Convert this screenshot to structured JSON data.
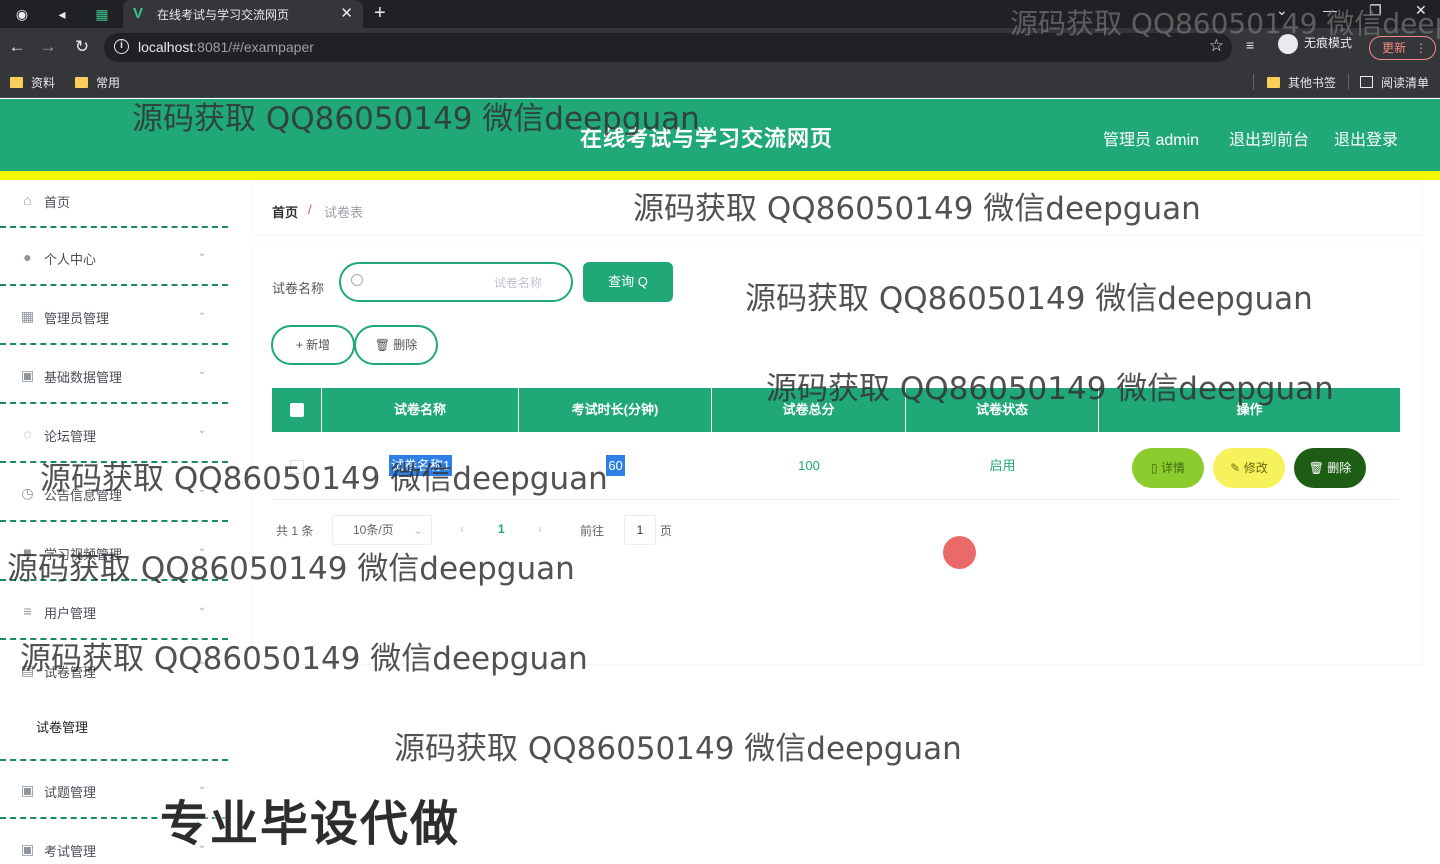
{
  "browser": {
    "tab_title": "在线考试与学习交流网页",
    "url_host": "localhost",
    "url_rest": ":8081/#/exampaper",
    "incognito_label": "无痕模式",
    "update_label": "更新",
    "bookmarks": [
      "资料",
      "常用"
    ],
    "bookmarks_right": [
      "其他书签",
      "阅读清单"
    ]
  },
  "header": {
    "title": "在线考试与学习交流网页",
    "user_label": "管理员 admin",
    "to_front_label": "退出到前台",
    "logout_label": "退出登录"
  },
  "sidebar": {
    "items": [
      {
        "label": "首页",
        "icon": "home-icon",
        "expandable": false
      },
      {
        "label": "个人中心",
        "icon": "user-icon",
        "expandable": true
      },
      {
        "label": "管理员管理",
        "icon": "grid-icon",
        "expandable": true
      },
      {
        "label": "基础数据管理",
        "icon": "clipboard-icon",
        "expandable": true
      },
      {
        "label": "论坛管理",
        "icon": "power-icon",
        "expandable": true
      },
      {
        "label": "公告信息管理",
        "icon": "clock-icon",
        "expandable": true
      },
      {
        "label": "学习视频管理",
        "icon": "video-icon",
        "expandable": true
      },
      {
        "label": "用户管理",
        "icon": "list-icon",
        "expandable": true
      },
      {
        "label": "试卷管理",
        "icon": "paper-icon",
        "expandable": true
      },
      {
        "label": "试题管理",
        "icon": "question-icon",
        "expandable": true
      },
      {
        "label": "考试管理",
        "icon": "exam-icon",
        "expandable": true
      }
    ],
    "submenu_label": "试卷管理"
  },
  "breadcrumb": {
    "home": "首页",
    "separator": "/",
    "current": "试卷表"
  },
  "search": {
    "label": "试卷名称",
    "placeholder": "试卷名称",
    "query_label": "查询 Q"
  },
  "actions": {
    "add_label": "+ 新增",
    "delete_label": "删除"
  },
  "table": {
    "columns": [
      "试卷名称",
      "考试时长(分钟)",
      "试卷总分",
      "试卷状态",
      "操作"
    ],
    "rows": [
      {
        "name": "试卷名称1",
        "duration": "60",
        "score": "100",
        "status": "启用"
      }
    ],
    "row_buttons": {
      "detail": "详情",
      "edit": "修改",
      "delete": "删除"
    }
  },
  "pagination": {
    "total": "共 1 条",
    "page_size": "10条/页",
    "current_page": "1",
    "goto_prefix": "前往",
    "goto_value": "1",
    "goto_suffix": "页"
  },
  "watermark": {
    "text": "源码获取 QQ86050149 微信deepguan",
    "big_text": "专业毕设代做"
  },
  "colors": {
    "primary": "#20a876",
    "accent_bar": "#f5f50a",
    "detail_btn": "#8ccc2e",
    "edit_btn": "#f6f25c",
    "delete_btn": "#1d5e14"
  }
}
